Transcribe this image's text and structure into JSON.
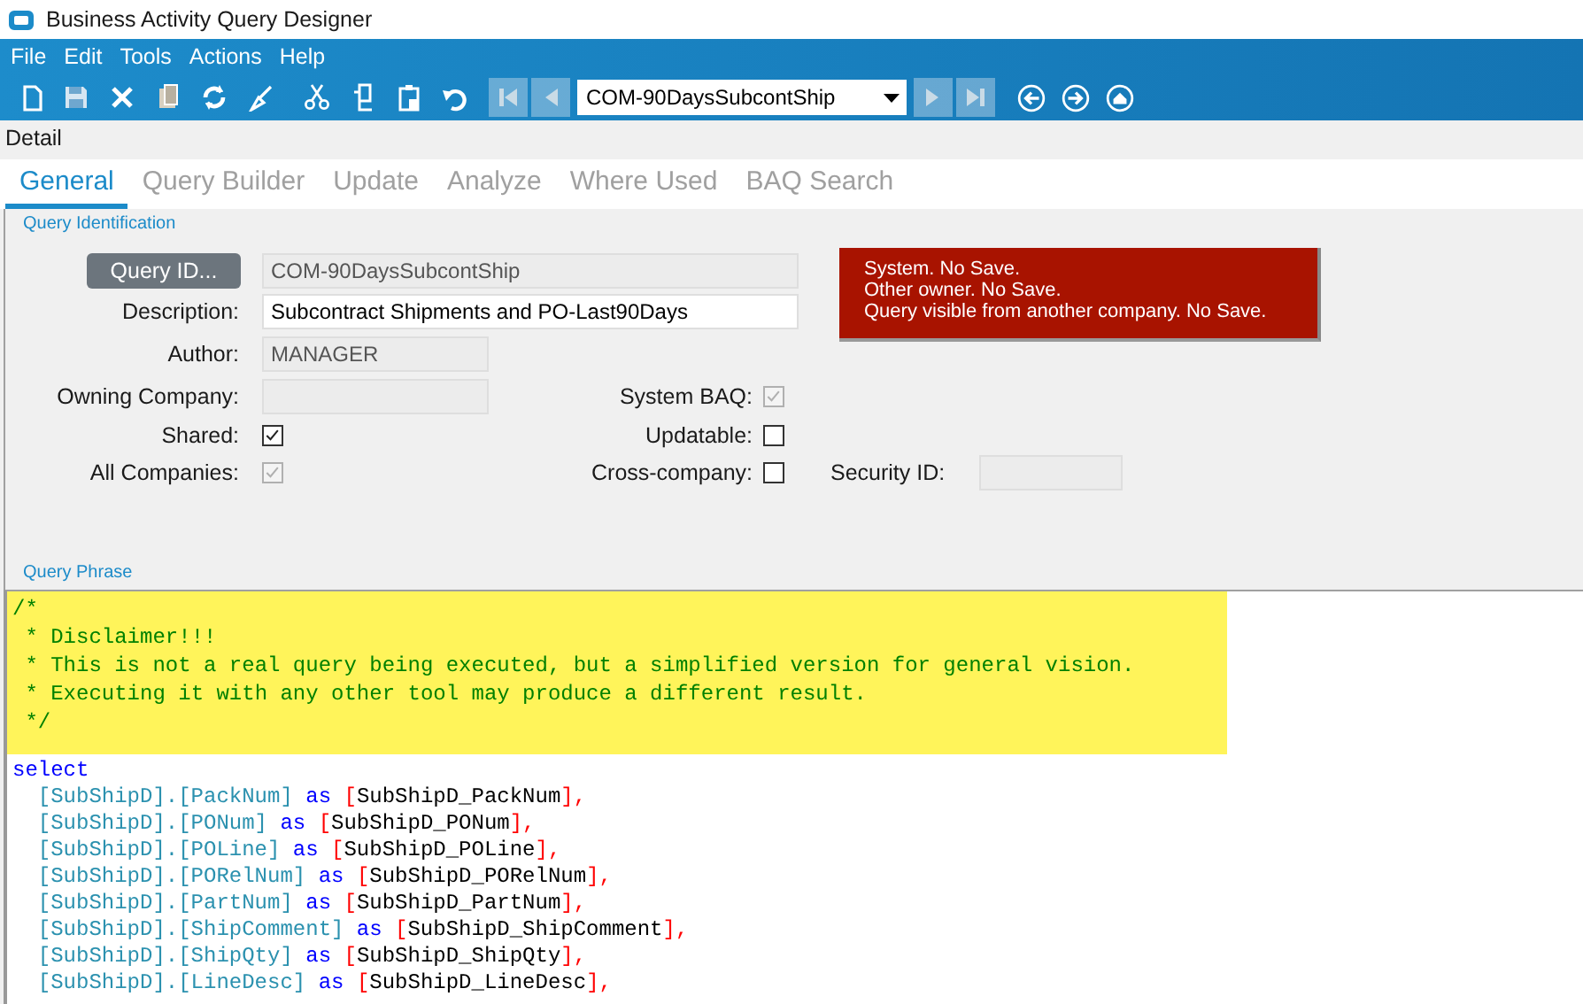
{
  "window": {
    "title": "Business Activity Query Designer"
  },
  "menu": [
    "File",
    "Edit",
    "Tools",
    "Actions",
    "Help"
  ],
  "toolbar": {
    "tools": [
      {
        "kind": "new"
      },
      {
        "kind": "save"
      },
      {
        "kind": "delete"
      },
      {
        "kind": "clipboard"
      },
      {
        "kind": "refresh"
      },
      {
        "kind": "clear"
      },
      {
        "kind": "cut"
      },
      {
        "kind": "copy"
      },
      {
        "kind": "paste"
      },
      {
        "kind": "undo"
      }
    ],
    "nav_back": [
      {
        "kind": "first",
        "disabled": true
      },
      {
        "kind": "previous",
        "disabled": true
      }
    ],
    "record_select": "COM-90DaysSubcontShip",
    "nav_forward": [
      {
        "kind": "next",
        "disabled": true
      },
      {
        "kind": "last",
        "disabled": true
      }
    ],
    "browse": [
      {
        "kind": "back"
      },
      {
        "kind": "forward"
      },
      {
        "kind": "home"
      }
    ]
  },
  "section": "Detail",
  "tabs": [
    {
      "label": "General",
      "selected": true
    },
    {
      "label": "Query Builder",
      "selected": false
    },
    {
      "label": "Update",
      "selected": false
    },
    {
      "label": "Analyze",
      "selected": false
    },
    {
      "label": "Where Used",
      "selected": false
    },
    {
      "label": "BAQ Search",
      "selected": false
    }
  ],
  "query_identification": {
    "title": "Query Identification",
    "query_id_button": "Query ID...",
    "query_id": {
      "value": "COM-90DaysSubcontShip",
      "disabled": true
    },
    "description": {
      "label": "Description:",
      "value": "Subcontract Shipments and PO-Last90Days",
      "disabled": false
    },
    "author": {
      "label": "Author:",
      "value": "MANAGER",
      "disabled": true
    },
    "owning_company": {
      "label": "Owning Company:",
      "disabled": true
    },
    "system_baq": {
      "label": "System BAQ:",
      "checked": true,
      "disabled": true
    },
    "shared": {
      "label": "Shared:",
      "checked": true,
      "disabled": false
    },
    "updatable": {
      "label": "Updatable:",
      "checked": false,
      "disabled": false
    },
    "all_companies": {
      "label": "All Companies:",
      "checked": true,
      "disabled": true
    },
    "cross_company": {
      "label": "Cross-company:",
      "checked": false,
      "disabled": false
    },
    "security_id": {
      "label": "Security ID:",
      "disabled": true
    },
    "warnings": [
      "System. No Save.",
      "Other owner. No Save.",
      "Query visible from another company. No Save."
    ]
  },
  "query_phrase": {
    "title": "Query Phrase",
    "comment_lines": [
      "/*",
      " * Disclaimer!!!",
      " * This is not a real query being executed, but a simplified version for general vision.",
      " * Executing it with any other tool may produce a different result.",
      " */"
    ],
    "code_lines": [
      {
        "keyword": "select"
      },
      {
        "field": "[SubShipD].[PackNum]",
        "keyword": "as",
        "open": "[",
        "alias": "SubShipD_PackNum",
        "close": "],"
      },
      {
        "field": "[SubShipD].[PONum]",
        "keyword": "as",
        "open": "[",
        "alias": "SubShipD_PONum",
        "close": "],"
      },
      {
        "field": "[SubShipD].[POLine]",
        "keyword": "as",
        "open": "[",
        "alias": "SubShipD_POLine",
        "close": "],"
      },
      {
        "field": "[SubShipD].[PORelNum]",
        "keyword": "as",
        "open": "[",
        "alias": "SubShipD_PORelNum",
        "close": "],"
      },
      {
        "field": "[SubShipD].[PartNum]",
        "keyword": "as",
        "open": "[",
        "alias": "SubShipD_PartNum",
        "close": "],"
      },
      {
        "field": "[SubShipD].[ShipComment]",
        "keyword": "as",
        "open": "[",
        "alias": "SubShipD_ShipComment",
        "close": "],"
      },
      {
        "field": "[SubShipD].[ShipQty]",
        "keyword": "as",
        "open": "[",
        "alias": "SubShipD_ShipQty",
        "close": "],"
      },
      {
        "field": "[SubShipD].[LineDesc]",
        "keyword": "as",
        "open": "[",
        "alias": "SubShipD_LineDesc",
        "close": "],"
      }
    ]
  }
}
